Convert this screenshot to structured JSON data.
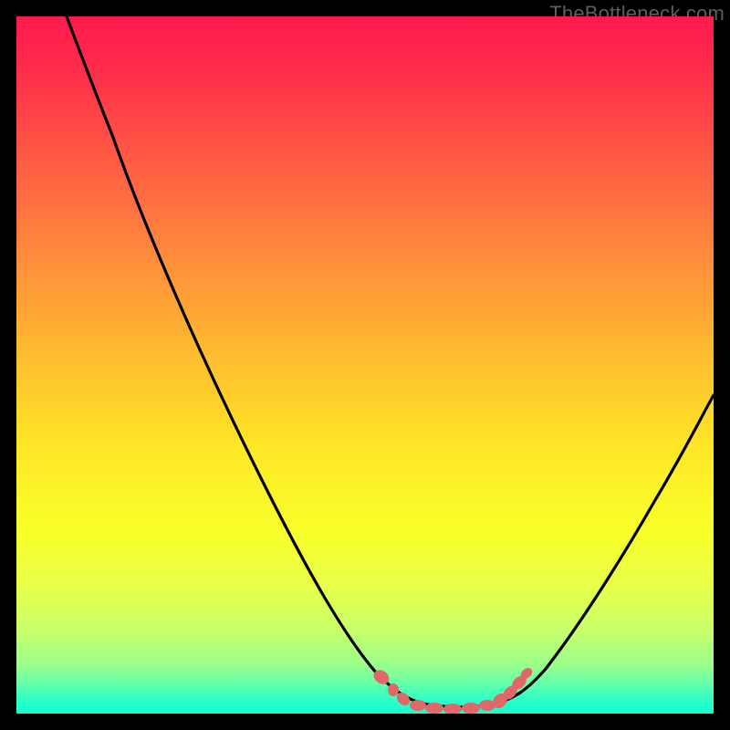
{
  "watermark": {
    "text": "TheBottleneck.com"
  },
  "colors": {
    "background": "#000000",
    "curve_stroke": "#000000",
    "marker_fill": "#e06868",
    "gradient_top": "#ff1a4d",
    "gradient_bottom": "#11ffd0"
  },
  "chart_data": {
    "type": "line",
    "title": "",
    "xlabel": "",
    "ylabel": "",
    "xlim": [
      0,
      100
    ],
    "ylim": [
      0,
      100
    ],
    "series": [
      {
        "name": "bottleneck-curve",
        "note": "y is approximate bottleneck % read from plot height; minimum (~0%) around x≈56–68",
        "x": [
          0,
          3,
          6,
          10,
          15,
          20,
          25,
          30,
          35,
          40,
          45,
          48,
          50,
          52,
          55,
          58,
          62,
          66,
          68,
          70,
          74,
          78,
          82,
          86,
          90,
          95,
          100
        ],
        "y": [
          100,
          98,
          95,
          90,
          82,
          73,
          64,
          55,
          46,
          36,
          26,
          19,
          14,
          10,
          5,
          2,
          0,
          0,
          1,
          3,
          8,
          15,
          23,
          31,
          39,
          49,
          59
        ]
      }
    ],
    "markers": {
      "name": "highlighted-range",
      "note": "pink dotted segment near the trough",
      "x": [
        50,
        52,
        55,
        58,
        60,
        62,
        64,
        66,
        68,
        70
      ],
      "y": [
        5,
        3.5,
        2,
        1,
        0.8,
        0.6,
        0.6,
        0.8,
        1.2,
        2
      ]
    }
  }
}
